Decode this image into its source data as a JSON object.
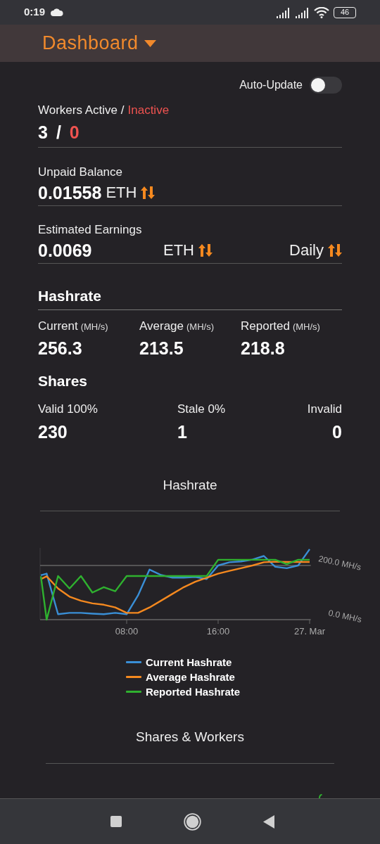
{
  "status_bar": {
    "time": "0:19",
    "battery": "46"
  },
  "header": {
    "title": "Dashboard"
  },
  "auto_update": {
    "label": "Auto-Update",
    "on": false
  },
  "workers": {
    "label_active": "Workers Active /",
    "label_inactive": "Inactive",
    "active": "3",
    "separator": "/",
    "inactive": "0"
  },
  "unpaid_balance": {
    "label": "Unpaid Balance",
    "value": "0.01558",
    "currency": "ETH"
  },
  "estimated_earnings": {
    "label": "Estimated Earnings",
    "value": "0.0069",
    "currency": "ETH",
    "period": "Daily"
  },
  "hashrate": {
    "title": "Hashrate",
    "stats": [
      {
        "label": "Current",
        "unit": "(MH/s)",
        "value": "256.3"
      },
      {
        "label": "Average",
        "unit": "(MH/s)",
        "value": "213.5"
      },
      {
        "label": "Reported",
        "unit": "(MH/s)",
        "value": "218.8"
      }
    ]
  },
  "shares": {
    "title": "Shares",
    "stats": [
      {
        "label": "Valid 100%",
        "value": "230"
      },
      {
        "label": "Stale 0%",
        "value": "1"
      },
      {
        "label": "Invalid",
        "value": "0"
      }
    ]
  },
  "hashrate_chart": {
    "chart_data": {
      "type": "line",
      "title": "Hashrate",
      "x": [
        0.5,
        1,
        2,
        3,
        4,
        5,
        6,
        7,
        8,
        9,
        10,
        11,
        12,
        13,
        14,
        15,
        16,
        17,
        18,
        19,
        20,
        21,
        22,
        23,
        24
      ],
      "xlim": [
        0.43,
        24.1
      ],
      "ylim": [
        0,
        265
      ],
      "xticks": [
        {
          "value": 8,
          "label": "08:00"
        },
        {
          "value": 16,
          "label": "16:00"
        },
        {
          "value": 24,
          "label": "27. Mar"
        }
      ],
      "yticks": [
        {
          "value": 0,
          "label": "0.0 MH/s"
        },
        {
          "value": 200,
          "label": "200.0 MH/s"
        }
      ],
      "series": [
        {
          "name": "Current Hashrate",
          "color": "#3a8fd6",
          "values": [
            164,
            170,
            20,
            25,
            25,
            22,
            20,
            25,
            20,
            90,
            185,
            165,
            155,
            155,
            158,
            150,
            200,
            212,
            215,
            222,
            235,
            195,
            190,
            200,
            260
          ]
        },
        {
          "name": "Average Hashrate",
          "color": "#f5891f",
          "values": [
            150,
            160,
            115,
            85,
            70,
            60,
            55,
            45,
            25,
            25,
            45,
            70,
            95,
            120,
            140,
            155,
            170,
            180,
            190,
            200,
            212,
            214,
            213,
            213,
            213
          ]
        },
        {
          "name": "Reported Hashrate",
          "color": "#2fb12f",
          "values": [
            160,
            0,
            161,
            115,
            161,
            100,
            120,
            105,
            161,
            161,
            161,
            161,
            161,
            161,
            161,
            161,
            221,
            221,
            221,
            221,
            221,
            221,
            205,
            221,
            221
          ]
        }
      ]
    }
  },
  "shares_workers_chart": {
    "title": "Shares & Workers"
  }
}
